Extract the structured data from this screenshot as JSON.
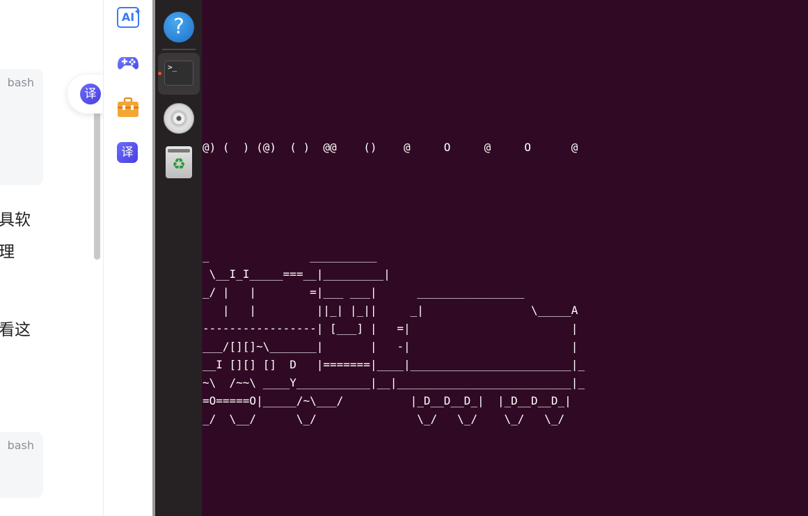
{
  "article": {
    "code_blocks": [
      {
        "lang": "bash"
      },
      {
        "lang": "bash"
      }
    ],
    "text_fragments": [
      "具软",
      "理",
      "看这"
    ]
  },
  "floating_button": {
    "label": "译"
  },
  "tool_sidebar": {
    "items": [
      {
        "name": "ai-assistant",
        "label": "AI",
        "icon": "ai-sparkle-icon"
      },
      {
        "name": "games",
        "icon": "gamepad-icon"
      },
      {
        "name": "toolbox",
        "icon": "toolbox-icon"
      },
      {
        "name": "translate",
        "label": "译",
        "icon": "translate-icon"
      }
    ]
  },
  "dock": {
    "help_label": "?",
    "terminal_prompt": ">_",
    "trash_symbol": "♻",
    "running_indicator_color": "#e95420"
  },
  "terminal": {
    "background": "#300a24",
    "smoke_line": "@) (  ) (@)  ( )  @@    ()    @     O     @     O      @",
    "train_lines": [
      "_               __________",
      " \\__I_I_____===__|_________|",
      "_/ |   |        =|___ ___|      ________________",
      "   |   |         ||_| |_||     _|                \\_____A",
      "-----------------| [___] |   =|                        |",
      "___/[][]~\\_______|       |   -|                        |",
      "__I [][] []  D   |=======|____|________________________|_",
      "~\\  /~~\\ ____Y___________|__|__________________________|_",
      "=O=====O|_____/~\\___/          |_D__D__D_|  |_D__D__D_|",
      "_/  \\__/      \\_/               \\_/   \\_/    \\_/   \\_/"
    ]
  }
}
